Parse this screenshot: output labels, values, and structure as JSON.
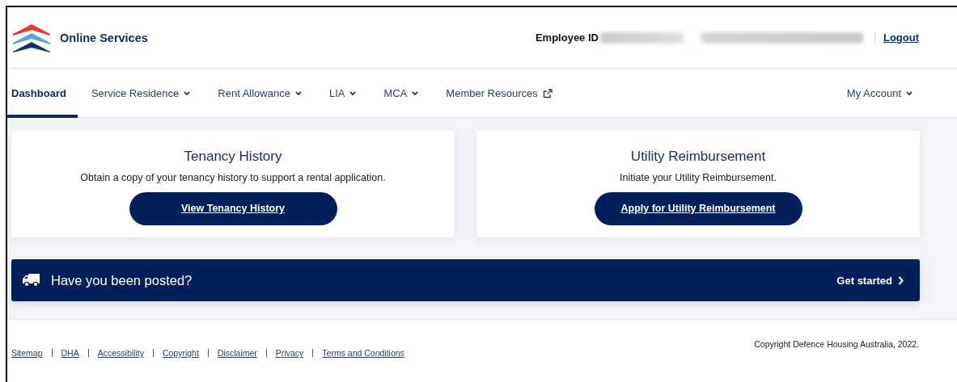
{
  "header": {
    "brand": "Online Services",
    "employee_label": "Employee ID",
    "logout": "Logout"
  },
  "nav": {
    "items": [
      {
        "label": "Dashboard",
        "kind": "plain",
        "selected": true
      },
      {
        "label": "Service Residence",
        "kind": "dropdown",
        "selected": false
      },
      {
        "label": "Rent Allowance",
        "kind": "dropdown",
        "selected": false
      },
      {
        "label": "LIA",
        "kind": "dropdown",
        "selected": false
      },
      {
        "label": "MCA",
        "kind": "dropdown",
        "selected": false
      },
      {
        "label": "Member Resources",
        "kind": "external",
        "selected": false
      }
    ],
    "account": {
      "label": "My Account",
      "kind": "dropdown"
    }
  },
  "cards": [
    {
      "title": "Tenancy History",
      "text": "Obtain a copy of your tenancy history to support a rental application.",
      "button": "View Tenancy History"
    },
    {
      "title": "Utility Reimbursement",
      "text": "Initiate your Utility Reimbursement.",
      "button": "Apply for Utility Reimbursement"
    }
  ],
  "banner": {
    "text": "Have you been posted?",
    "action": "Get started"
  },
  "footer": {
    "links": [
      "Sitemap",
      "DHA",
      "Accessibility",
      "Copyright",
      "Disclaimer",
      "Privacy",
      "Terms and Conditions"
    ],
    "copyright": "Copyright Defence Housing Australia, 2022."
  }
}
